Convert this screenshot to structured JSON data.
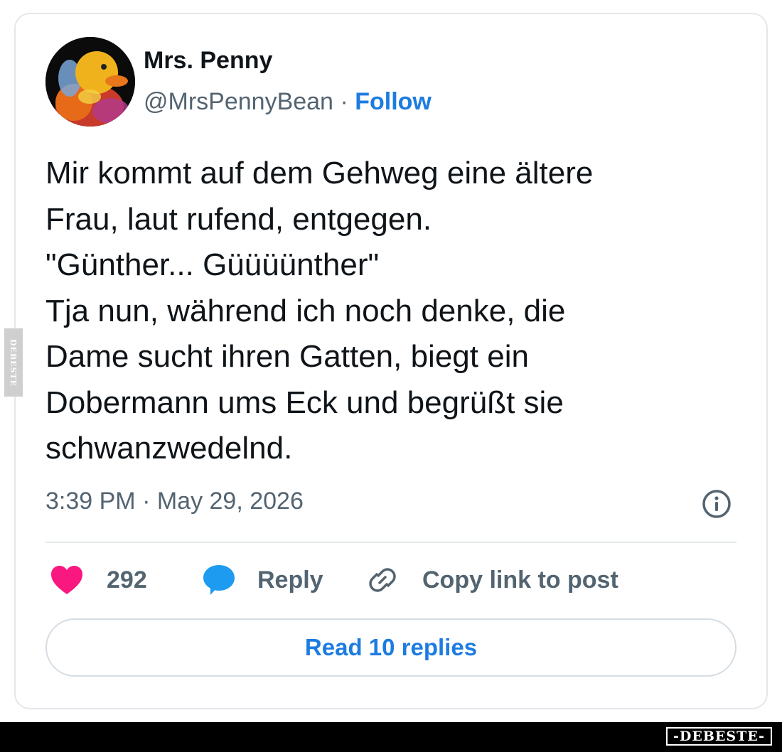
{
  "tweet": {
    "display_name": "Mrs. Penny",
    "handle": "@MrsPennyBean",
    "separator": "·",
    "follow_label": "Follow",
    "text_lines": [
      "Mir kommt auf dem Gehweg eine ältere",
      "Frau, laut rufend, entgegen.",
      "\"Günther... Güüüünther\"",
      "Tja nun, während ich noch denke, die",
      "Dame sucht ihren Gatten, biegt ein",
      "Dobermann ums Eck und begrüßt sie",
      "schwanzwedelnd."
    ],
    "timestamp": "3:39 PM · May 29, 2026",
    "like_count": "292",
    "reply_label": "Reply",
    "copy_link_label": "Copy link to post",
    "read_replies_label": "Read 10 replies"
  },
  "icons": {
    "avatar": "rubber-duck-avatar",
    "info": "info-icon",
    "like": "heart-icon",
    "reply": "speech-bubble-icon",
    "copy_link": "link-icon"
  },
  "colors": {
    "accent": "#1d7ce0",
    "heart": "#f91880",
    "reply_icon": "#1d9bf0",
    "muted_text": "#536471"
  },
  "watermark": {
    "side": "DEBESTE",
    "bottom": "-DEBESTE-"
  }
}
